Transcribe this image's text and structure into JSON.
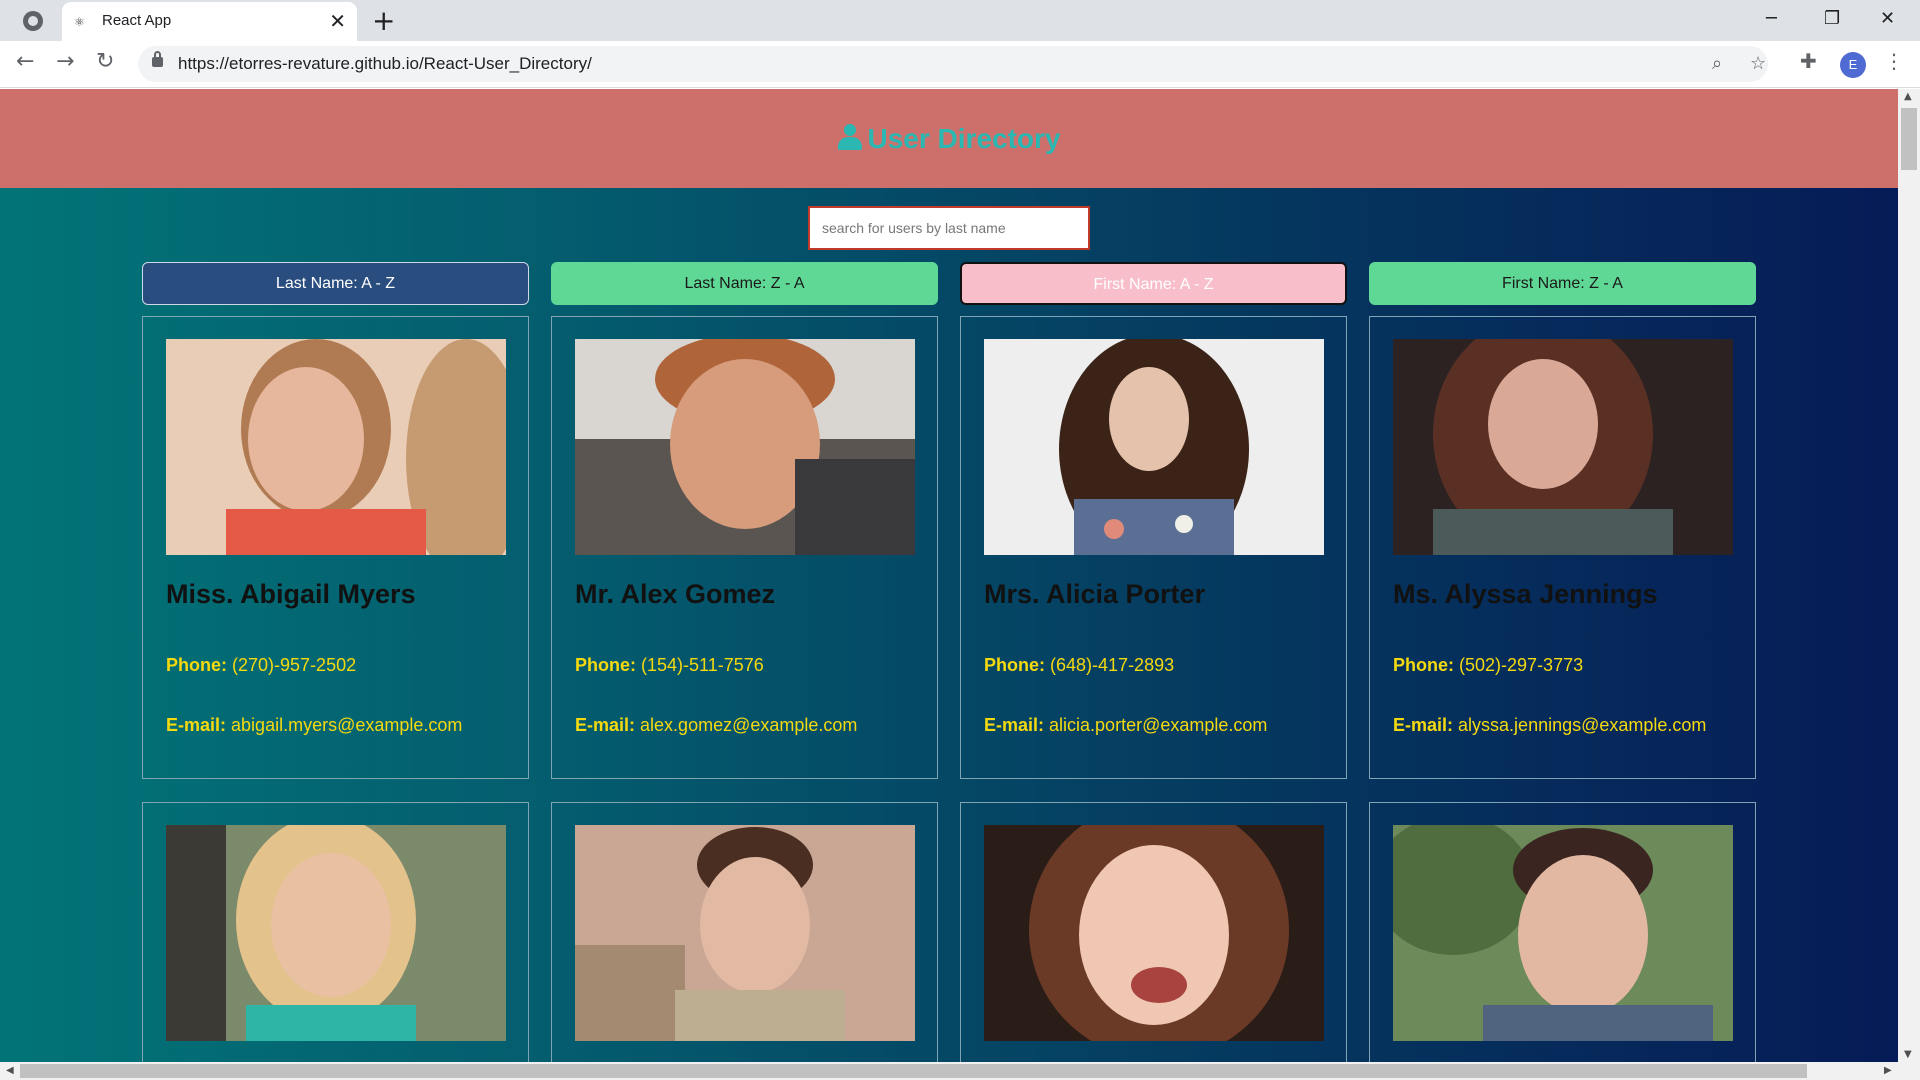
{
  "browser": {
    "tab_title": "React App",
    "tab_close": "✕",
    "new_tab": "+",
    "url": "https://etorres-revature.github.io/React-User_Directory/",
    "profile_initial": "E",
    "icons": [
      "globe-icon",
      "react-favicon",
      "back-icon",
      "forward-icon",
      "reload-icon",
      "lock-icon",
      "zoom-icon",
      "star-icon",
      "extensions-icon",
      "menu-icon"
    ]
  },
  "header": {
    "title": "User Directory",
    "icon": "user-icon",
    "bg": "#cd706b",
    "accent": "#2bb8b3"
  },
  "search": {
    "placeholder": "search for users by last name"
  },
  "sort_buttons": [
    {
      "label": "Last Name: A - Z"
    },
    {
      "label": "Last Name: Z - A"
    },
    {
      "label": "First Name: A - Z"
    },
    {
      "label": "First Name: Z - A"
    }
  ],
  "labels": {
    "phone": "Phone:",
    "email": "E-mail:"
  },
  "users": [
    {
      "name": "Miss. Abigail Myers",
      "phone": "(270)-957-2502",
      "email": "abigail.myers@example.com"
    },
    {
      "name": "Mr. Alex Gomez",
      "phone": "(154)-511-7576",
      "email": "alex.gomez@example.com"
    },
    {
      "name": "Mrs. Alicia Porter",
      "phone": "(648)-417-2893",
      "email": "alicia.porter@example.com"
    },
    {
      "name": "Ms. Alyssa Jennings",
      "phone": "(502)-297-3773",
      "email": "alyssa.jennings@example.com"
    },
    {
      "name": "",
      "phone": "",
      "email": ""
    },
    {
      "name": "",
      "phone": "",
      "email": ""
    },
    {
      "name": "",
      "phone": "",
      "email": ""
    },
    {
      "name": "",
      "phone": "",
      "email": ""
    }
  ],
  "colors": {
    "text_yellow": "#f5d90f",
    "btn_green": "#5fd896",
    "btn_navy": "#2a4d80",
    "btn_pink": "#f8bfcb"
  }
}
